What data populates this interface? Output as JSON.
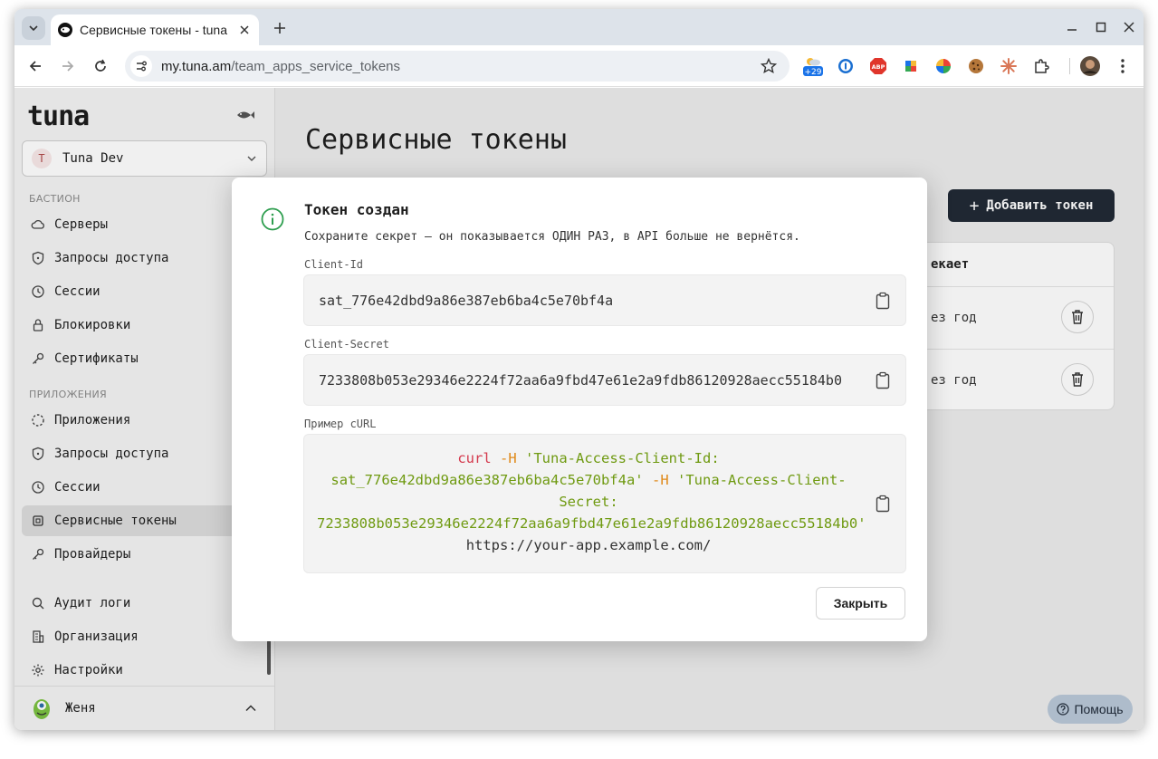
{
  "browser": {
    "tab_title": "Сервисные токены - tuna",
    "url_host": "my.tuna.am",
    "url_path": "/team_apps_service_tokens",
    "extension_badge": "+29"
  },
  "sidebar": {
    "logo": "tuna",
    "team_avatar": "T",
    "team_name": "Tuna Dev",
    "section_bastion": "БАСТИОН",
    "bastion_items": [
      {
        "label": "Серверы",
        "icon": "cloud-icon"
      },
      {
        "label": "Запросы доступа",
        "icon": "shield-icon"
      },
      {
        "label": "Сессии",
        "icon": "clock-icon"
      },
      {
        "label": "Блокировки",
        "icon": "lock-icon"
      },
      {
        "label": "Сертификаты",
        "icon": "key-icon"
      }
    ],
    "section_apps": "ПРИЛОЖЕНИЯ",
    "app_items": [
      {
        "label": "Приложения",
        "icon": "dashed-circle-icon"
      },
      {
        "label": "Запросы доступа",
        "icon": "shield-icon"
      },
      {
        "label": "Сессии",
        "icon": "clock-icon"
      },
      {
        "label": "Сервисные токены",
        "icon": "chip-icon"
      },
      {
        "label": "Провайдеры",
        "icon": "key-icon"
      }
    ],
    "bottom_items": [
      {
        "label": "Аудит логи",
        "icon": "search-icon"
      },
      {
        "label": "Организация",
        "icon": "building-icon"
      },
      {
        "label": "Настройки",
        "icon": "gear-icon"
      }
    ],
    "user_name": "Женя"
  },
  "main": {
    "title": "Сервисные токены",
    "add_button": "Добавить токен",
    "table_header_expires": "екает",
    "rows": [
      {
        "expires": "ез год"
      },
      {
        "expires": "ез год"
      }
    ],
    "help_button": "Помощь"
  },
  "dialog": {
    "title": "Токен создан",
    "description": "Сохраните секрет — он показывается ОДИН РАЗ, в API больше не вернётся.",
    "client_id_label": "Client-Id",
    "client_id": "sat_776e42dbd9a86e387eb6ba4c5e70bf4a",
    "client_secret_label": "Client-Secret",
    "client_secret": "7233808b053e29346e2224f72aa6a9fbd47e61e2a9fdb86120928aecc55184b0",
    "curl_label": "Пример cURL",
    "curl": {
      "cmd": "curl",
      "flag": "-H",
      "header1_a": "'Tuna-Access-Client-Id:",
      "header1_b": "sat_776e42dbd9a86e387eb6ba4c5e70bf4a'",
      "header2_a": "'Tuna-Access-Client-",
      "header2_b": "Secret:",
      "header2_c": "7233808b053e29346e2224f72aa6a9fbd47e61e2a9fdb86120928aecc55184b0'",
      "url": "https://your-app.example.com/"
    },
    "close_button": "Закрыть"
  },
  "colors": {
    "primary_button": "#212a36",
    "success_icon": "#2e9e4f",
    "curl_command": "#d4394d",
    "curl_flag": "#e08a1a",
    "curl_string": "#6f9a11"
  }
}
